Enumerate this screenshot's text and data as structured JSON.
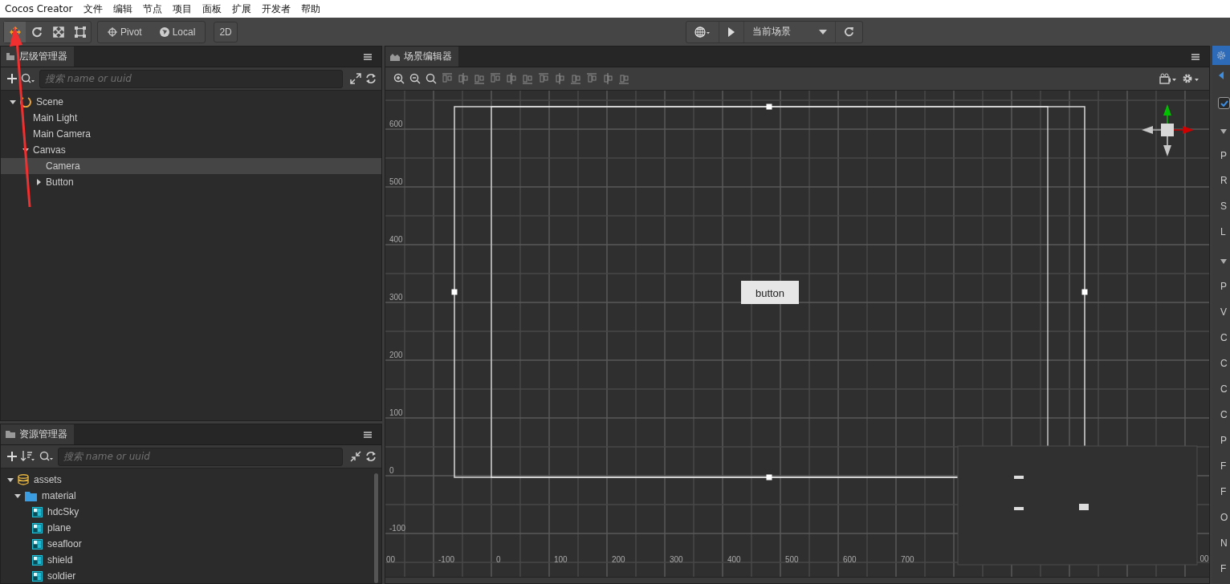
{
  "menu": [
    "Cocos Creator",
    "文件",
    "编辑",
    "节点",
    "项目",
    "面板",
    "扩展",
    "开发者",
    "帮助"
  ],
  "toolbar": {
    "tools": [
      {
        "kind": "move",
        "selected": true
      },
      {
        "kind": "rotate",
        "selected": false
      },
      {
        "kind": "scale",
        "selected": false
      },
      {
        "kind": "rect",
        "selected": false
      }
    ],
    "pivot": "Pivot",
    "local": "Local",
    "mode": "2D",
    "scene_select": "当前场景"
  },
  "hierarchy": {
    "title": "层级管理器",
    "placeholder": "搜索 name or uuid",
    "tree": [
      {
        "name": "Scene",
        "kind": "scene",
        "expanded": true,
        "selected": false,
        "children": [
          {
            "name": "Main Light",
            "selected": false
          },
          {
            "name": "Main Camera",
            "selected": false
          },
          {
            "name": "Canvas",
            "expanded": true,
            "selected": false,
            "children": [
              {
                "name": "Camera",
                "selected": true
              },
              {
                "name": "Button",
                "expanded": false,
                "selected": false
              }
            ]
          }
        ]
      }
    ]
  },
  "assets": {
    "title": "资源管理器",
    "placeholder": "搜索 name or uuid",
    "tree": [
      {
        "name": "assets",
        "kind": "database",
        "expanded": true,
        "children": [
          {
            "name": "material",
            "kind": "folder",
            "expanded": true,
            "children": [
              {
                "name": "hdcSky",
                "kind": "material"
              },
              {
                "name": "plane",
                "kind": "material"
              },
              {
                "name": "seafloor",
                "kind": "material"
              },
              {
                "name": "shield",
                "kind": "material"
              },
              {
                "name": "soldier",
                "kind": "material"
              }
            ]
          }
        ]
      }
    ]
  },
  "scene": {
    "title": "场景编辑器",
    "button_label": "button",
    "y_labels": [
      "600",
      "500",
      "400",
      "300",
      "200",
      "100",
      "0",
      "-100"
    ],
    "x_labels": [
      "00",
      "-100",
      "0",
      "100",
      "200",
      "300",
      "400",
      "500",
      "600",
      "700",
      "00"
    ]
  },
  "inspector": {
    "enabled": true,
    "rows": [
      "P",
      "R",
      "S",
      "L",
      "P",
      "V",
      "C",
      "C",
      "C",
      "C",
      "P",
      "F",
      "F",
      "O",
      "N",
      "F"
    ]
  }
}
